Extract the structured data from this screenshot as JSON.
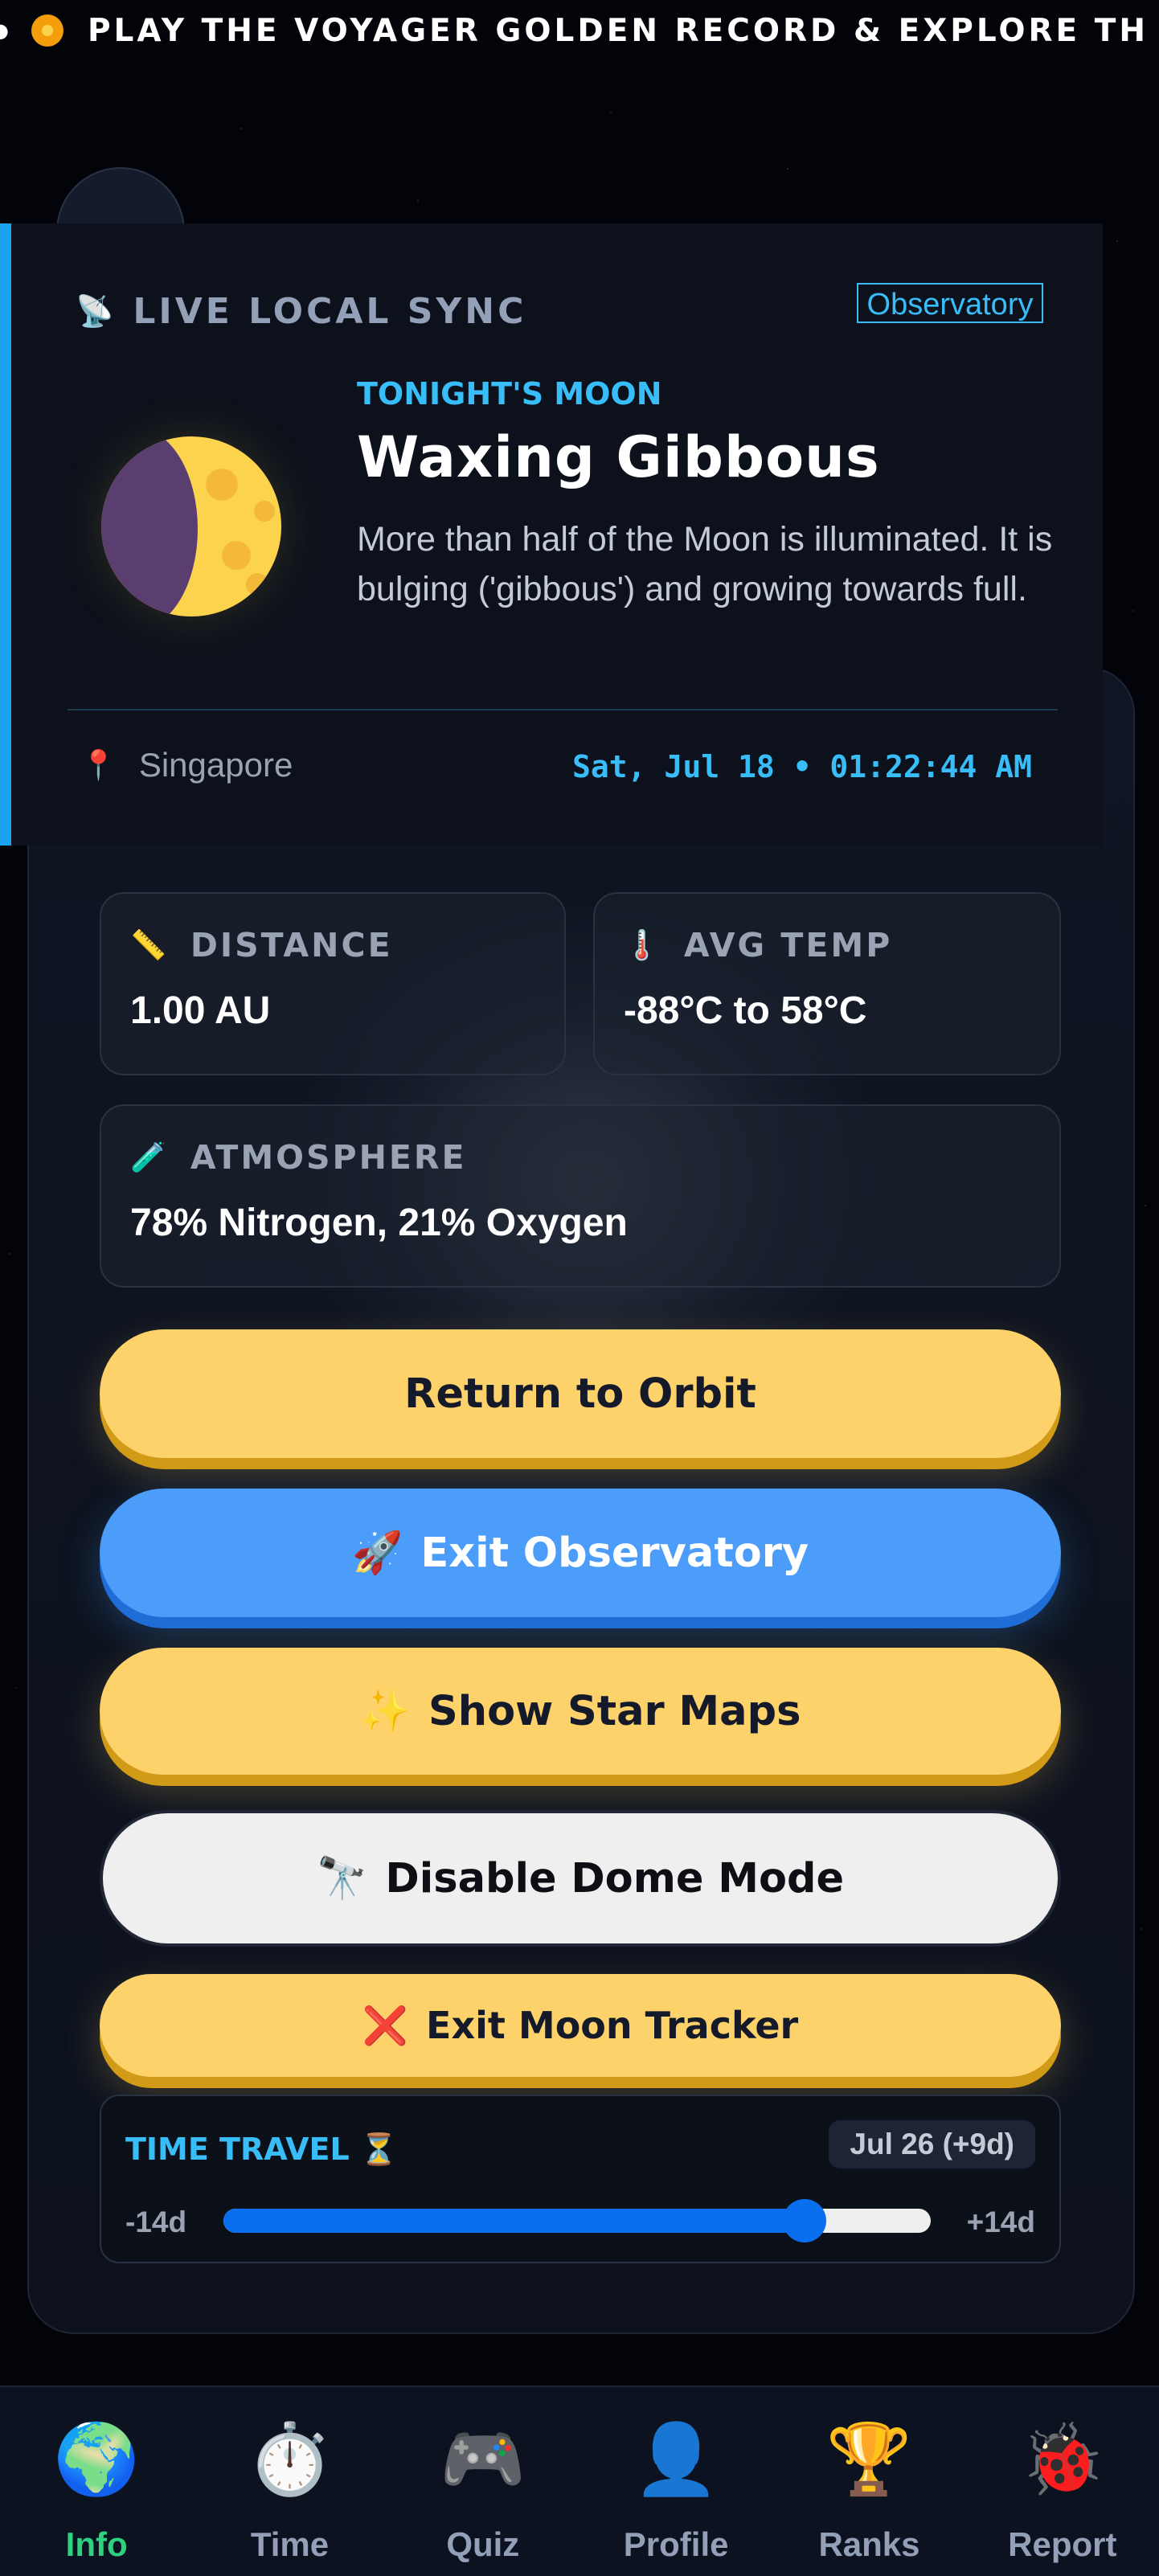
{
  "ticker": {
    "text": "PLAY THE VOYAGER GOLDEN RECORD & EXPLORE TH"
  },
  "sync": {
    "title": "LIVE LOCAL SYNC",
    "tag": "Observatory",
    "moon_label": "TONIGHT'S MOON",
    "moon_phase": "Waxing Gibbous",
    "description": "More than half of the Moon is illuminated. It is bulging ('gibbous') and growing towards full.",
    "location": "Singapore",
    "datetime": "Sat, Jul 18 • 01:22:44 AM"
  },
  "stats": {
    "distance": {
      "label": "DISTANCE",
      "value": "1.00 AU",
      "icon": "ruler-icon"
    },
    "avg_temp": {
      "label": "AVG TEMP",
      "value": "-88°C to 58°C",
      "icon": "thermometer-icon"
    },
    "atmosphere": {
      "label": "ATMOSPHERE",
      "value": "78% Nitrogen, 21% Oxygen",
      "icon": "test-tube-icon"
    }
  },
  "buttons": {
    "return_orbit": "Return to Orbit",
    "exit_observatory": "Exit Observatory",
    "star_maps": "Show Star Maps",
    "dome_mode": "Disable Dome Mode",
    "exit_tracker": "Exit Moon Tracker"
  },
  "time_travel": {
    "title": "TIME TRAVEL",
    "current": "Jul 26 (+9d)",
    "min_label": "-14d",
    "max_label": "+14d",
    "min": -14,
    "max": 14,
    "value": 9
  },
  "nav": {
    "items": [
      {
        "label": "Info",
        "icon": "globe-icon",
        "active": true
      },
      {
        "label": "Time",
        "icon": "stopwatch-icon"
      },
      {
        "label": "Quiz",
        "icon": "gamepad-icon"
      },
      {
        "label": "Profile",
        "icon": "user-icon"
      },
      {
        "label": "Ranks",
        "icon": "trophy-icon"
      },
      {
        "label": "Report",
        "icon": "ladybug-icon"
      }
    ]
  },
  "colors": {
    "accent_blue": "#38bdf8",
    "button_yellow": "#fdd26b",
    "button_blue": "#4c9dfa",
    "active_nav": "#2fd07f"
  }
}
